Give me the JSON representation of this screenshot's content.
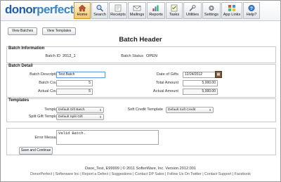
{
  "header": {
    "logo_part1": "donor",
    "logo_part2": "perfect",
    "nav": [
      {
        "label": "Home",
        "icon": "home-icon",
        "active": true
      },
      {
        "label": "Search",
        "icon": "search-icon",
        "active": false
      },
      {
        "label": "Receipts",
        "icon": "receipts-icon",
        "active": false
      },
      {
        "label": "Mailings",
        "icon": "mailings-icon",
        "active": false
      },
      {
        "label": "Reports",
        "icon": "reports-icon",
        "active": false
      },
      {
        "label": "Tasks",
        "icon": "tasks-icon",
        "active": false
      },
      {
        "label": "Utilities",
        "icon": "utilities-icon",
        "active": false
      },
      {
        "label": "Settings",
        "icon": "settings-icon",
        "active": false
      },
      {
        "label": "App Links",
        "icon": "app-links-icon",
        "active": false
      },
      {
        "label": "Help?",
        "icon": "help-icon",
        "active": false
      }
    ]
  },
  "toolbar": {
    "view_batches": "View Batches",
    "view_templates": "View Templates"
  },
  "page_title": "Batch Header",
  "batch_info": {
    "section_title": "Batch Information",
    "batch_id_label": "Batch ID",
    "batch_id_value": "2012_1",
    "batch_status_label": "Batch Status",
    "batch_status_value": "OPEN"
  },
  "batch_detail": {
    "section_title": "Batch Detail",
    "description_label": "Batch Description",
    "description_value": "Test Batch",
    "date_of_gifts_label": "Date of Gifts",
    "date_of_gifts_value": "12/24/2012",
    "batch_count_label": "Batch Count",
    "batch_count_value": "5",
    "total_amount_label": "Total Amount",
    "total_amount_value": "5,000.00",
    "actual_count_label": "Actual Count",
    "actual_count_value": "5",
    "actual_amount_label": "Actual Amount",
    "actual_amount_value": "5,000.00"
  },
  "templates": {
    "section_title": "Templates",
    "template_label": "Template",
    "template_value": "Default Gift Batch",
    "soft_credit_label": "Soft Credit Template",
    "soft_credit_value": "Default Soft Credit",
    "split_gift_label": "Split Gift Template",
    "split_gift_value": "Default Split Gift"
  },
  "messages": {
    "error_label": "Error Message",
    "error_value": "Valid Batch.",
    "save_button": "Save and Continue"
  },
  "footer": {
    "line1": "Dave_Test, E99999 | © 2011 SofterWare, Inc. Version 2012.001",
    "line2": "DonorPerfect | Softerware Inc | Report a Defect | Suggestions | Contact DP Sales | Follow Us On Twitter | Contact Support | Facebook"
  },
  "colors": {
    "brand_dark": "#1f5fa8",
    "brand_light": "#3d86c6",
    "active_nav": "#f3c76e"
  }
}
